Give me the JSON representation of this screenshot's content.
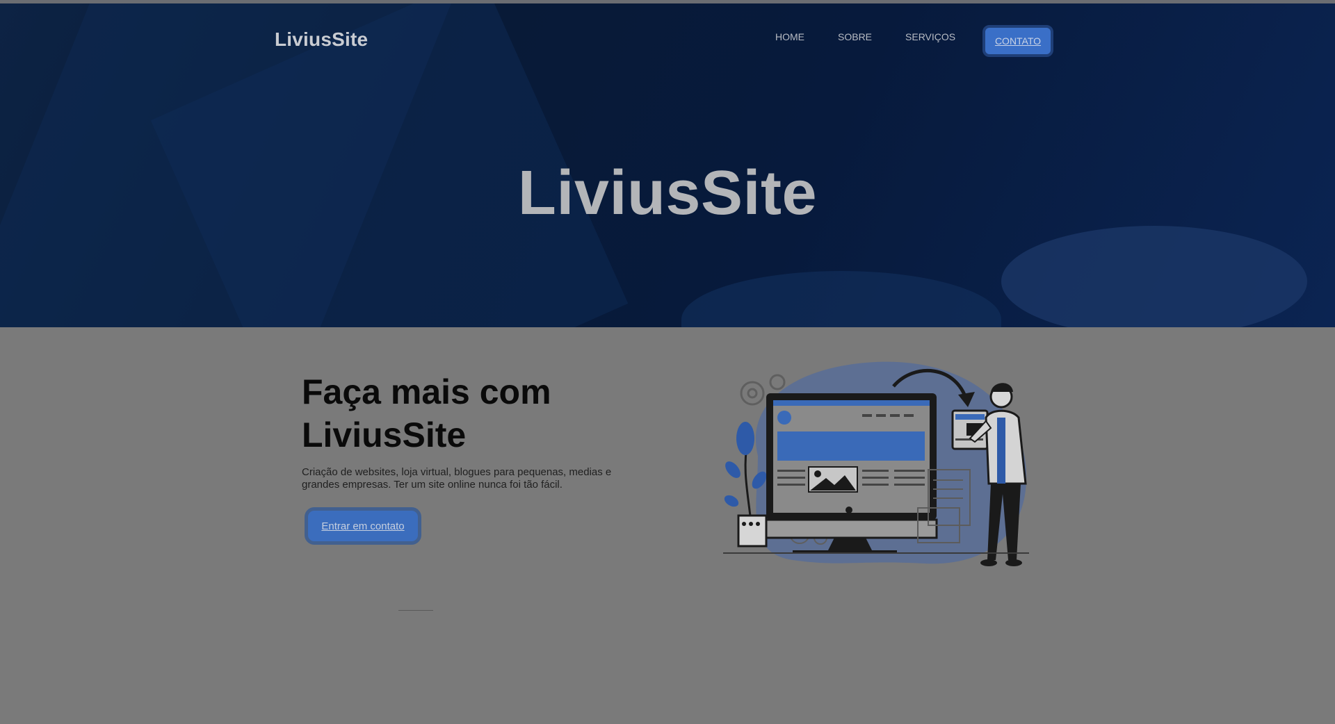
{
  "header": {
    "logo": "LiviusSite",
    "nav": [
      {
        "label": "HOME"
      },
      {
        "label": "SOBRE"
      },
      {
        "label": "SERVIÇOS"
      }
    ],
    "cta": "CONTATO"
  },
  "hero": {
    "title": "LiviusSite"
  },
  "main": {
    "headline_line1": "Faça mais com",
    "headline_line2": "LiviusSite",
    "description": "Criação de websites, loja virtual, blogues para pequenas, medias e grandes empresas. Ter um site online nunca foi tão fácil.",
    "button": "Entrar em contato"
  },
  "colors": {
    "accent": "#3b6dbd",
    "hero_bg": "#081a36",
    "page_bg": "#7a7a7a"
  },
  "icons": [
    "gear-icon",
    "monitor-icon",
    "plant-icon",
    "person-icon",
    "arrow-icon"
  ]
}
